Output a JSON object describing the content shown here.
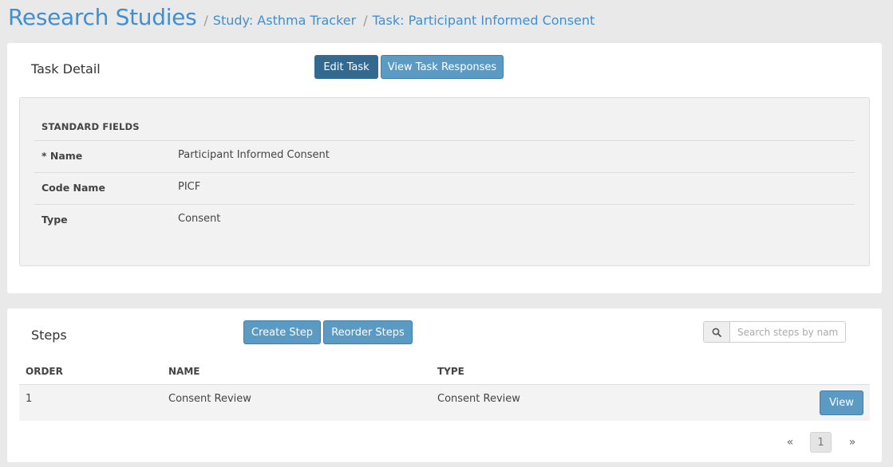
{
  "header": {
    "app_title": "Research Studies",
    "separator": "/",
    "crumbs": [
      "Study: Asthma Tracker",
      "Task: Participant Informed Consent"
    ]
  },
  "task_panel": {
    "title": "Task Detail",
    "buttons": {
      "edit": "Edit Task",
      "view_responses": "View Task Responses"
    },
    "section_heading": "STANDARD FIELDS",
    "fields": [
      {
        "label": "* Name",
        "value": "Participant Informed Consent"
      },
      {
        "label": "Code Name",
        "value": "PICF"
      },
      {
        "label": "Type",
        "value": "Consent"
      }
    ]
  },
  "steps_panel": {
    "title": "Steps",
    "buttons": {
      "create": "Create Step",
      "reorder": "Reorder Steps"
    },
    "search": {
      "placeholder": "Search steps by nam",
      "value": ""
    },
    "columns": [
      "ORDER",
      "NAME",
      "TYPE"
    ],
    "rows": [
      {
        "order": "1",
        "name": "Consent Review",
        "type": "Consent Review",
        "action": "View"
      }
    ],
    "pagination": {
      "prev": "«",
      "current": "1",
      "next": "»"
    }
  },
  "icons": {
    "search": "search-icon"
  },
  "colors": {
    "accent": "#3f8fd2",
    "button_dark": "#34698f",
    "button_light": "#5b9ac3"
  }
}
